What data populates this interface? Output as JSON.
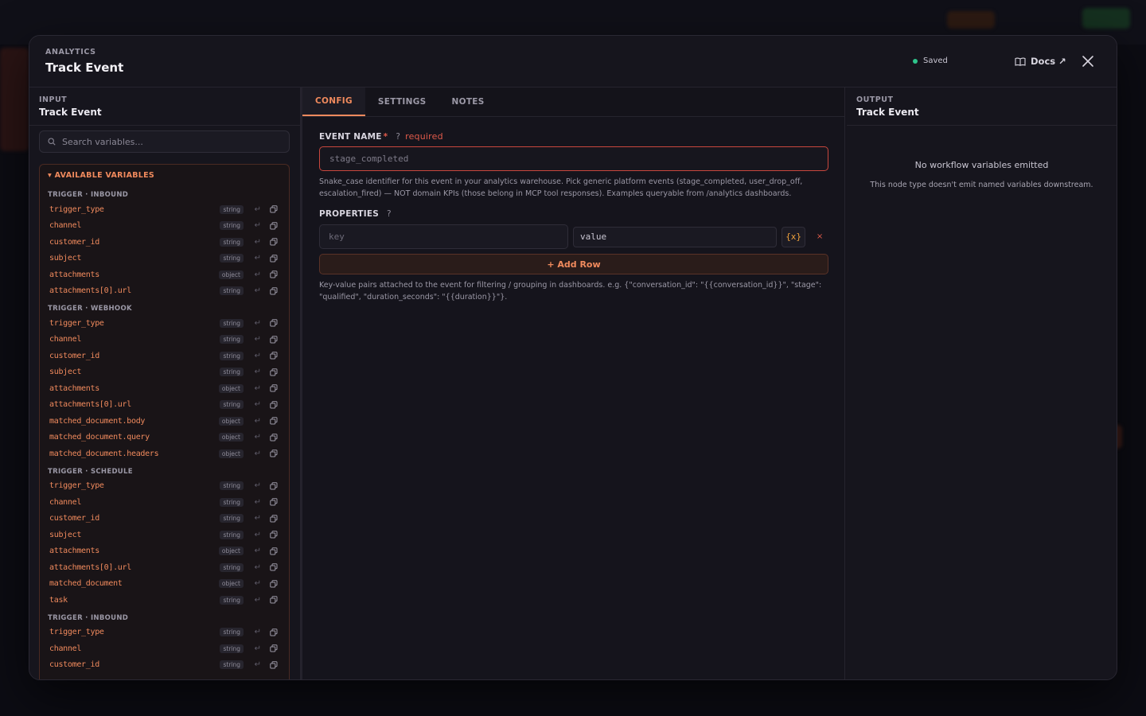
{
  "modal": {
    "kicker": "ANALYTICS",
    "title": "Track Event",
    "status": "Saved",
    "docs_label": "Docs ↗"
  },
  "input_panel": {
    "kicker": "INPUT",
    "title": "Track Event",
    "search_placeholder": "Search variables...",
    "variables_header": "▾ AVAILABLE VARIABLES",
    "groups": [
      {
        "label": "TRIGGER · INBOUND",
        "vars": [
          {
            "name": "trigger_type",
            "type": "string"
          },
          {
            "name": "channel",
            "type": "string"
          },
          {
            "name": "customer_id",
            "type": "string"
          },
          {
            "name": "subject",
            "type": "string"
          },
          {
            "name": "attachments",
            "type": "object"
          },
          {
            "name": "attachments[0].url",
            "type": "string"
          }
        ]
      },
      {
        "label": "TRIGGER · WEBHOOK",
        "vars": [
          {
            "name": "trigger_type",
            "type": "string"
          },
          {
            "name": "channel",
            "type": "string"
          },
          {
            "name": "customer_id",
            "type": "string"
          },
          {
            "name": "subject",
            "type": "string"
          },
          {
            "name": "attachments",
            "type": "object"
          },
          {
            "name": "attachments[0].url",
            "type": "string"
          },
          {
            "name": "matched_document.body",
            "type": "object"
          },
          {
            "name": "matched_document.query",
            "type": "object"
          },
          {
            "name": "matched_document.headers",
            "type": "object"
          }
        ]
      },
      {
        "label": "TRIGGER · SCHEDULE",
        "vars": [
          {
            "name": "trigger_type",
            "type": "string"
          },
          {
            "name": "channel",
            "type": "string"
          },
          {
            "name": "customer_id",
            "type": "string"
          },
          {
            "name": "subject",
            "type": "string"
          },
          {
            "name": "attachments",
            "type": "object"
          },
          {
            "name": "attachments[0].url",
            "type": "string"
          },
          {
            "name": "matched_document",
            "type": "object"
          },
          {
            "name": "task",
            "type": "string"
          }
        ]
      },
      {
        "label": "TRIGGER · INBOUND",
        "vars": [
          {
            "name": "trigger_type",
            "type": "string"
          },
          {
            "name": "channel",
            "type": "string"
          },
          {
            "name": "customer_id",
            "type": "string"
          }
        ]
      }
    ]
  },
  "config": {
    "tabs": [
      {
        "label": "CONFIG",
        "active": true
      },
      {
        "label": "SETTINGS",
        "active": false
      },
      {
        "label": "NOTES",
        "active": false
      }
    ],
    "event_name": {
      "label": "EVENT NAME",
      "required_star": "*",
      "help": "?",
      "required_text": "required",
      "placeholder": "stage_completed",
      "hint": "Snake_case identifier for this event in your analytics warehouse. Pick generic platform events (stage_completed, user_drop_off, escalation_fired) — NOT domain KPIs (those belong in MCP tool responses). Examples queryable from /analytics dashboards."
    },
    "properties": {
      "label": "PROPERTIES",
      "help": "?",
      "key_placeholder": "key",
      "value_placeholder": "value",
      "fx_label": "{x}",
      "delete_label": "×",
      "add_row_label": "+ Add Row",
      "hint": "Key-value pairs attached to the event for filtering / grouping in dashboards. e.g. {\"conversation_id\": \"{{conversation_id}}\", \"stage\": \"qualified\", \"duration_seconds\": \"{{duration}}\"}."
    }
  },
  "output_panel": {
    "kicker": "OUTPUT",
    "title": "Track Event",
    "empty_title": "No workflow variables emitted",
    "empty_sub": "This node type doesn't emit named variables downstream."
  },
  "colors": {
    "accent": "#f08a5d",
    "error": "#e05a4a",
    "success": "#2ec48b",
    "background": "#15141c"
  }
}
